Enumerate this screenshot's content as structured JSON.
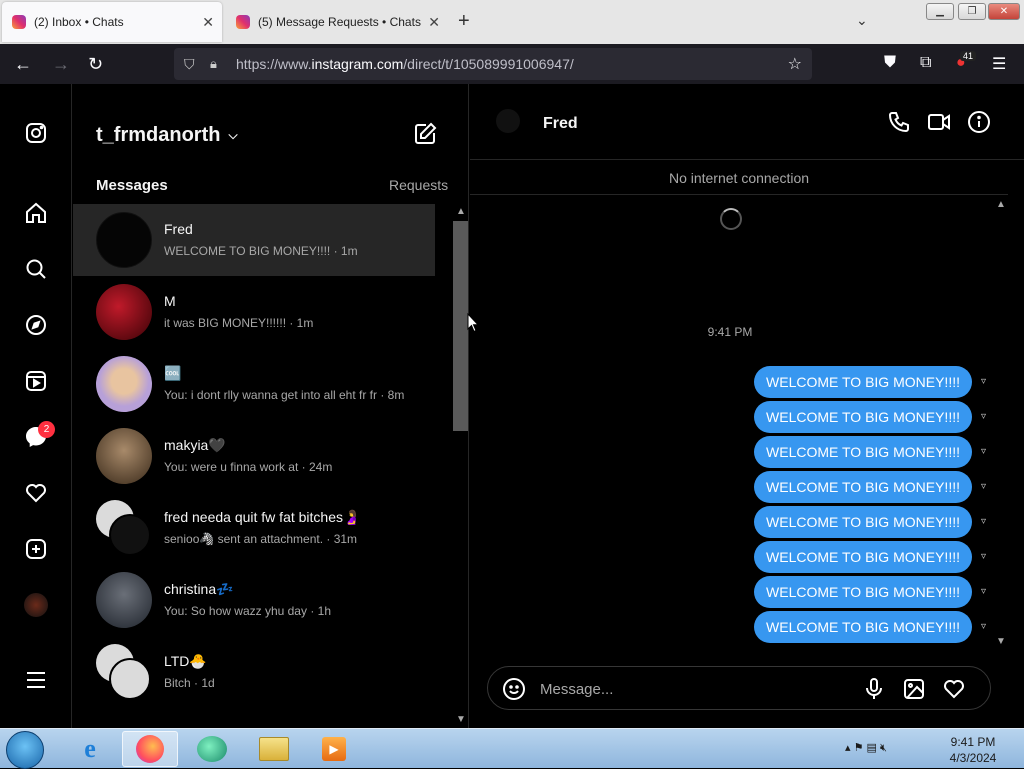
{
  "browser": {
    "tabs": [
      {
        "title": "(2) Inbox • Chats",
        "active": true
      },
      {
        "title": "(5) Message Requests • Chats",
        "active": false
      }
    ],
    "url_prefix": "https://www.",
    "url_domain": "instagram.com",
    "url_path": "/direct/t/105089991006947/",
    "extension_badge": "41"
  },
  "rail": {
    "messages_badge": "2"
  },
  "inbox": {
    "account": "t_frmdanorth",
    "messages_heading": "Messages",
    "requests_label": "Requests",
    "threads": [
      {
        "name": "Fred",
        "preview": "WELCOME TO BIG MONEY!!!! · 1m",
        "selected": true,
        "avatar_color": "#050505"
      },
      {
        "name": "M",
        "preview": "it was BIG MONEY!!!!!! · 1m",
        "selected": false,
        "avatar_color": "#8b0a14"
      },
      {
        "name": "🆒",
        "preview": "You: i dont rlly wanna get into all eht fr fr · 8m",
        "selected": false,
        "avatar_color": "#b7a0d8"
      },
      {
        "name": "makyia🖤",
        "preview": "You: were u finna work at · 24m",
        "selected": false,
        "avatar_color": "#6b5a45"
      },
      {
        "name": "fred needa quit fw fat bitches🤰",
        "preview": "senioo🦓 sent an attachment. · 31m",
        "selected": false,
        "avatar_color": "#dbdbdb"
      },
      {
        "name": "christina💤",
        "preview": "You: So how wazz yhu day · 1h",
        "selected": false,
        "avatar_color": "#3d4450"
      },
      {
        "name": "LTD🐣",
        "preview": "Bitch · 1d",
        "selected": false,
        "avatar_color": "#dbdbdb"
      }
    ]
  },
  "conversation": {
    "contact_name": "Fred",
    "network_status": "No internet connection",
    "timestamp": "9:41 PM",
    "messages": [
      "WELCOME TO BIG MONEY!!!!",
      "WELCOME TO BIG MONEY!!!!",
      "WELCOME TO BIG MONEY!!!!",
      "WELCOME TO BIG MONEY!!!!",
      "WELCOME TO BIG MONEY!!!!",
      "WELCOME TO BIG MONEY!!!!",
      "WELCOME TO BIG MONEY!!!!",
      "WELCOME TO BIG MONEY!!!!"
    ],
    "composer_placeholder": "Message..."
  },
  "taskbar": {
    "time": "9:41 PM",
    "date": "4/3/2024"
  },
  "colors": {
    "bubble": "#3797f0",
    "background": "#000000",
    "badge": "#ff3040"
  }
}
